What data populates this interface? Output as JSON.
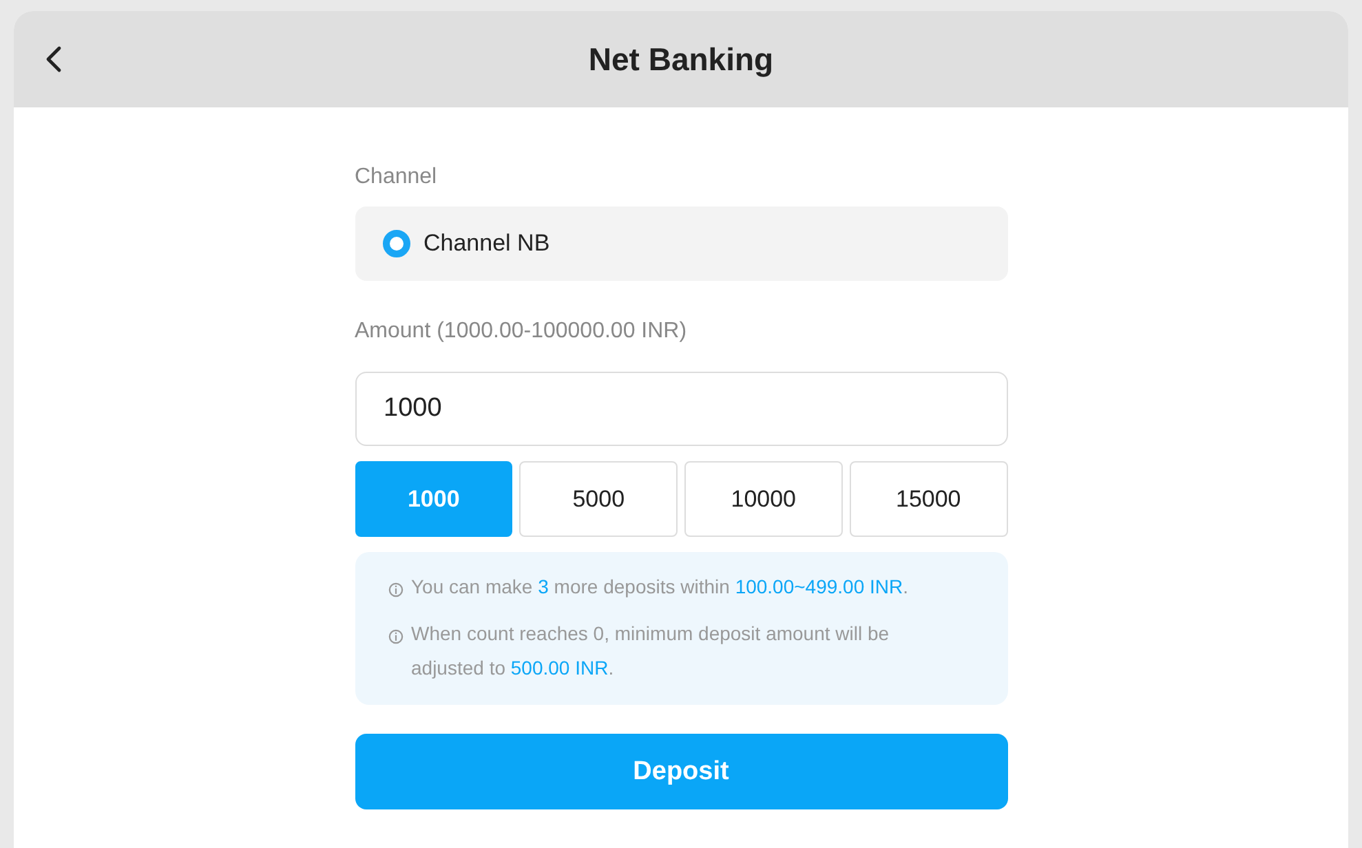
{
  "header": {
    "title": "Net Banking"
  },
  "channel": {
    "label": "Channel",
    "options": [
      {
        "label": "Channel NB",
        "selected": true
      }
    ]
  },
  "amount": {
    "label": "Amount (1000.00-100000.00 INR)",
    "value": "1000",
    "presets": [
      {
        "label": "1000",
        "selected": true
      },
      {
        "label": "5000",
        "selected": false
      },
      {
        "label": "10000",
        "selected": false
      },
      {
        "label": "15000",
        "selected": false
      }
    ]
  },
  "notices": [
    "You can make **3** more deposits within **100.00~499.00 INR**.",
    "When count reaches 0, minimum deposit amount will be adjusted to **500.00 INR**."
  ],
  "deposit_button": "Deposit"
}
